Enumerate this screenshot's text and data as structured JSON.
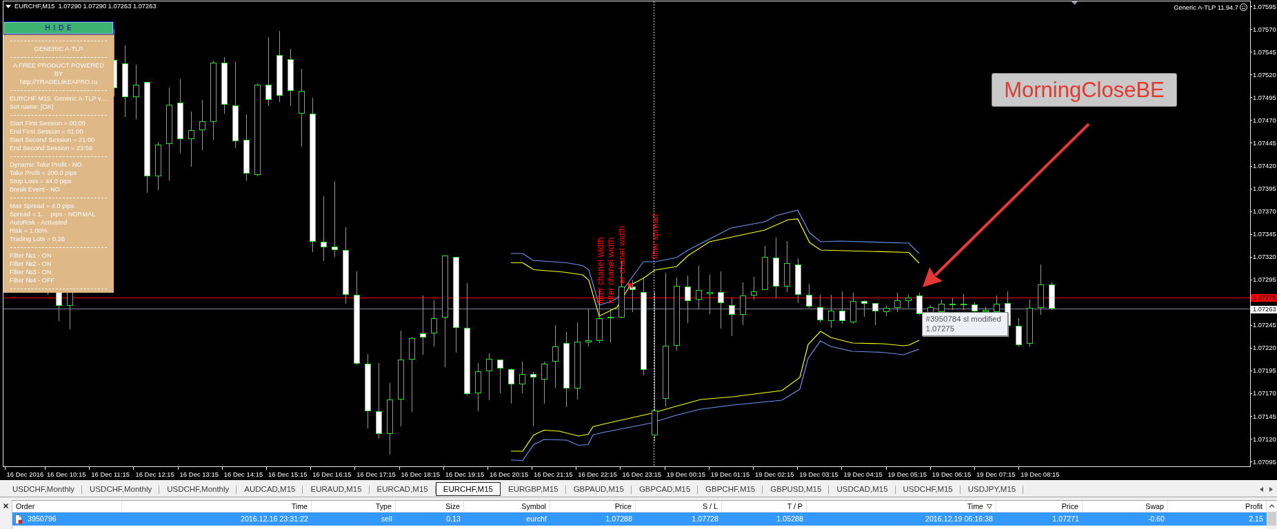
{
  "chart": {
    "symbol": "EURCHF,M15",
    "quotes": "1.07290 1.07290 1.07263 1.07263",
    "expert": "Generic A-TLP 11.94.7",
    "panel": {
      "hide_button": "H I D E",
      "sections": [
        {
          "kind": "centered",
          "lines": [
            "GENERIC A-TLP"
          ]
        },
        {
          "kind": "centered",
          "lines": [
            "A FREE PRODUCT POWERED",
            "BY",
            "http://TRADELIKEAPRO.ru"
          ]
        },
        {
          "kind": "left",
          "lines": [
            "EURCHF M15  Generic A-TLP v....",
            "Set name: [OK]"
          ]
        },
        {
          "kind": "left",
          "lines": [
            "Start First Session = 00:00",
            "End First Session = 01:00",
            "Start Second Session = 21:00",
            "End Second Session = 23:59"
          ]
        },
        {
          "kind": "left",
          "lines": [
            "Dynamic Take Profit - NO",
            "Take Profit = 200.0 pips",
            "Stop Loss = 44.0 pips",
            "Break Event - NO"
          ]
        },
        {
          "kind": "left",
          "lines": [
            "Max Spread = 4.0 pips",
            [
              "Spread = 1.",
              "pips - NORMAL"
            ],
            "AutoRisk - Activated",
            "Risk = 1.00%",
            "Trading Lots = 0.26"
          ]
        },
        {
          "kind": "left",
          "lines": [
            "Filter №1 - ON",
            "Filter №2 - ON",
            "Filter №3 - ON",
            "Filter №4 - OFF"
          ]
        }
      ]
    },
    "signal_labels": [
      "filter chanel width",
      "filter chanel width",
      "er chanel width",
      "filter spread"
    ],
    "callout": "MorningCloseBE",
    "tooltip": [
      "#3950784 sl modified",
      "1.07275"
    ]
  },
  "price_axis": {
    "upper_labels": [
      "1.07595",
      "1.07570",
      "1.07545",
      "1.07520",
      "1.07495",
      "1.07470",
      "1.07445",
      "1.07420",
      "1.07395",
      "1.07370",
      "1.07345",
      "1.07320",
      "1.07295"
    ],
    "stop_loss_marker": "1.07275",
    "bid_marker": "1.07263",
    "lower_labels": [
      "1.07245",
      "1.07220",
      "1.07195",
      "1.07170",
      "1.07145",
      "1.07120",
      "1.07095"
    ]
  },
  "time_axis": {
    "labels": [
      "16 Dec 2016",
      "16 Dec 10:15",
      "16 Dec 11:15",
      "16 Dec 12:15",
      "16 Dec 13:15",
      "16 Dec 14:15",
      "16 Dec 15:15",
      "16 Dec 16:15",
      "16 Dec 17:15",
      "16 Dec 18:15",
      "16 Dec 19:15",
      "16 Dec 20:15",
      "16 Dec 21:15",
      "16 Dec 22:15",
      "16 Dec 23:15",
      "19 Dec 00:15",
      "19 Dec 01:15",
      "19 Dec 02:15",
      "19 Dec 03:15",
      "19 Dec 04:15",
      "19 Dec 05:15",
      "19 Dec 06:15",
      "19 Dec 07:15",
      "19 Dec 08:15"
    ]
  },
  "symbol_tabs": [
    {
      "label": "USDCHF,Monthly",
      "selected": false
    },
    {
      "label": "USDCHF,Monthly",
      "selected": false
    },
    {
      "label": "USDCHF,Monthly",
      "selected": false
    },
    {
      "label": "AUDCAD,M15",
      "selected": false
    },
    {
      "label": "EURAUD,M15",
      "selected": false
    },
    {
      "label": "EURCAD,M15",
      "selected": false
    },
    {
      "label": "EURCHF,M15",
      "selected": true
    },
    {
      "label": "EURGBP,M15",
      "selected": false
    },
    {
      "label": "GBPAUD,M15",
      "selected": false
    },
    {
      "label": "GBPCAD,M15",
      "selected": false
    },
    {
      "label": "GBPCHF,M15",
      "selected": false
    },
    {
      "label": "GBPUSD,M15",
      "selected": false
    },
    {
      "label": "USDCAD,M15",
      "selected": false
    },
    {
      "label": "USDCHF,M15",
      "selected": false
    },
    {
      "label": "USDJPY,M15",
      "selected": false
    }
  ],
  "terminal": {
    "columns": [
      {
        "label": "Order",
        "sorted": false
      },
      {
        "label": "Time",
        "sorted": false
      },
      {
        "label": "Type",
        "sorted": false
      },
      {
        "label": "Size",
        "sorted": false
      },
      {
        "label": "Symbol",
        "sorted": false
      },
      {
        "label": "Price",
        "sorted": false
      },
      {
        "label": "S / L",
        "sorted": false
      },
      {
        "label": "T / P",
        "sorted": false
      },
      {
        "label": "Time",
        "sorted": true
      },
      {
        "label": "Price",
        "sorted": false
      },
      {
        "label": "Swap",
        "sorted": false
      },
      {
        "label": "Profit",
        "sorted": false
      }
    ],
    "rows": [
      {
        "selected": true,
        "cells": [
          "3950796",
          "2016.12.16 23:31:22",
          "sell",
          "0.13",
          "eurchf",
          "1.07288",
          "1.07728",
          "1.05288",
          "2016.12.19 06:16:38",
          "1.07271",
          "-0.60",
          "2.15"
        ]
      }
    ]
  }
}
